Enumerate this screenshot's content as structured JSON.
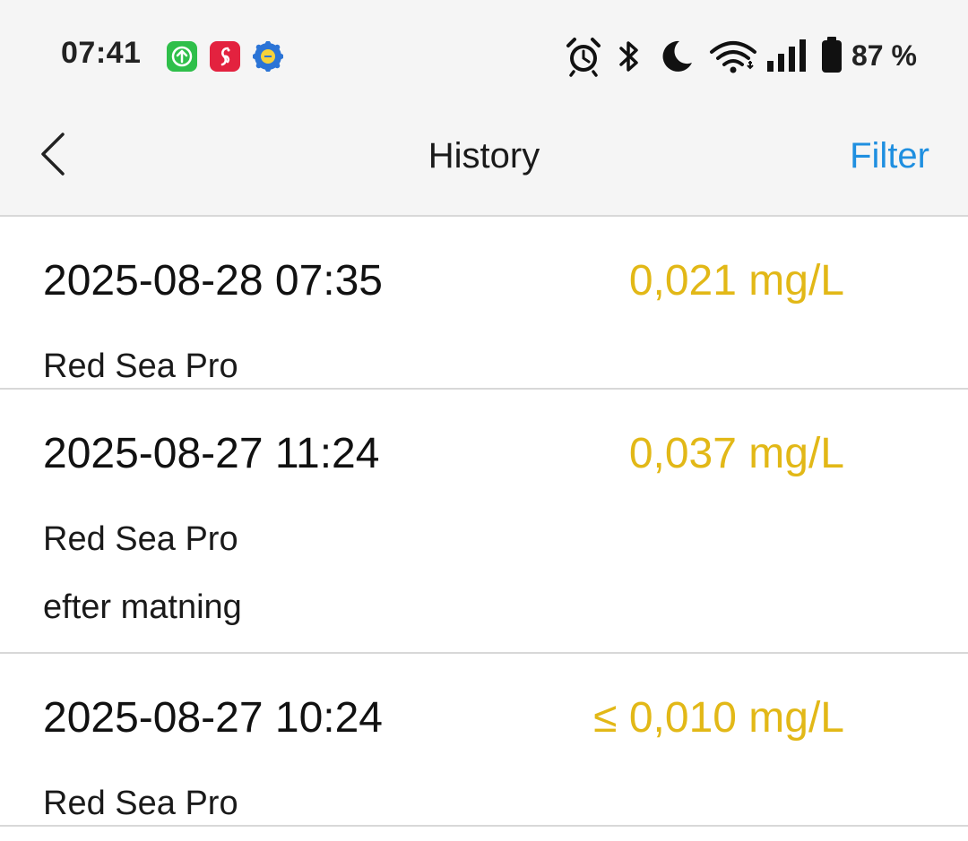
{
  "status_bar": {
    "time": "07:41",
    "battery_percent": "87 %",
    "icons": [
      "upload-app-icon",
      "seahorse-app-icon",
      "gear-badge-app-icon",
      "alarm-icon",
      "bluetooth-icon",
      "moon-icon",
      "wifi-icon",
      "signal-icon",
      "battery-icon"
    ]
  },
  "header": {
    "title": "History",
    "filter_label": "Filter",
    "back_icon": "chevron-left-icon"
  },
  "entries": [
    {
      "datetime": "2025-08-28 07:35",
      "value": "0,021 mg/L",
      "device": "Red Sea Pro",
      "note": ""
    },
    {
      "datetime": "2025-08-27 11:24",
      "value": "0,037 mg/L",
      "device": "Red Sea Pro",
      "note": "efter matning"
    },
    {
      "datetime": "2025-08-27 10:24",
      "value": "≤ 0,010 mg/L",
      "device": "Red Sea Pro",
      "note": ""
    }
  ],
  "colors": {
    "value": "#e2b817",
    "accent": "#1f8fe0",
    "bar_bg": "#f5f5f5"
  }
}
